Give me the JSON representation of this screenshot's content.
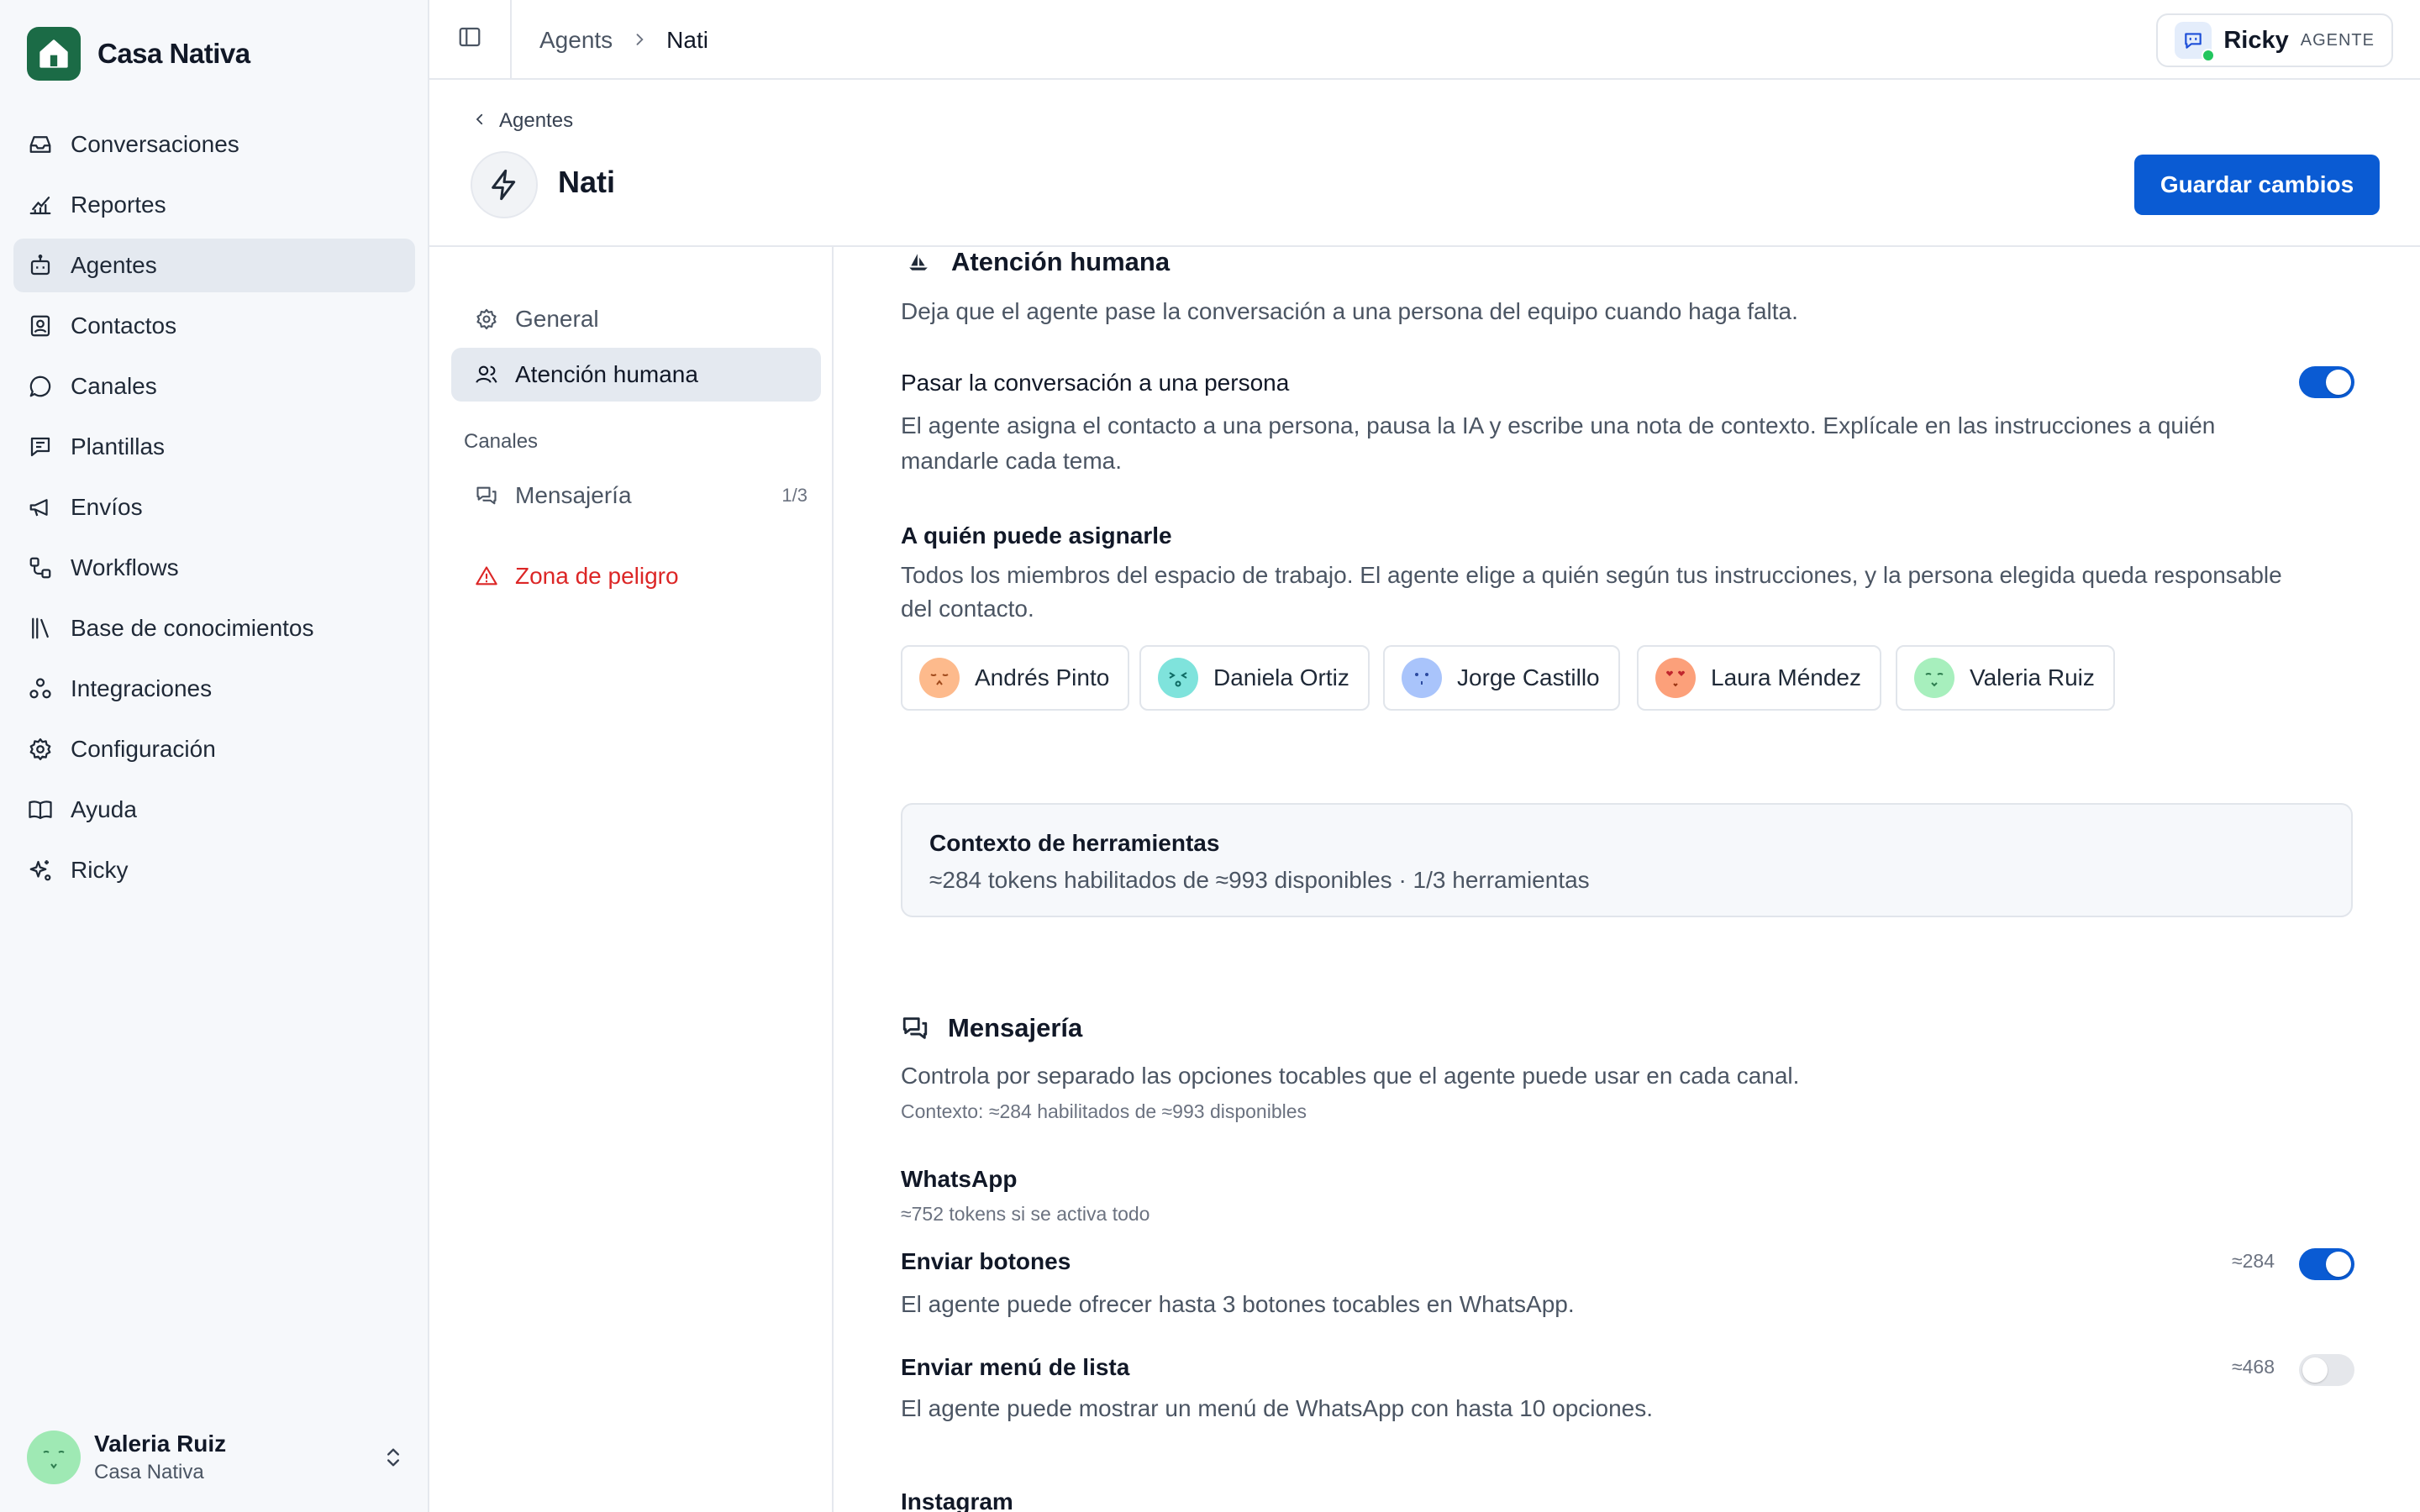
{
  "brand": {
    "name": "Casa Nativa"
  },
  "nav": {
    "items": [
      {
        "label": "Conversaciones",
        "icon": "inbox-icon"
      },
      {
        "label": "Reportes",
        "icon": "chart-line-icon"
      },
      {
        "label": "Agentes",
        "icon": "bot-icon",
        "active": true
      },
      {
        "label": "Contactos",
        "icon": "contact-icon"
      },
      {
        "label": "Canales",
        "icon": "message-circle-icon"
      },
      {
        "label": "Plantillas",
        "icon": "template-icon"
      },
      {
        "label": "Envíos",
        "icon": "megaphone-icon"
      },
      {
        "label": "Workflows",
        "icon": "workflow-icon"
      },
      {
        "label": "Base de conocimientos",
        "icon": "library-icon"
      },
      {
        "label": "Integraciones",
        "icon": "integrations-icon"
      },
      {
        "label": "Configuración",
        "icon": "gear-icon"
      },
      {
        "label": "Ayuda",
        "icon": "book-icon"
      },
      {
        "label": "Ricky",
        "icon": "sparkles-icon"
      }
    ]
  },
  "user": {
    "name": "Valeria Ruiz",
    "workspace": "Casa Nativa"
  },
  "topbar": {
    "breadcrumb": [
      "Agents",
      "Nati"
    ],
    "assistant": {
      "name": "Ricky",
      "role": "AGENTE"
    }
  },
  "header": {
    "back_label": "Agentes",
    "agent_name": "Nati",
    "save_label": "Guardar cambios"
  },
  "subnav": {
    "general": "General",
    "human": "Atención humana",
    "group_label": "Canales",
    "messaging": "Mensajería",
    "messaging_count": "1/3",
    "danger": "Zona de peligro"
  },
  "human_section": {
    "title": "Atención humana",
    "description": "Deja que el agente pase la conversación a una persona del equipo cuando haga falta.",
    "handoff_label": "Pasar la conversación a una persona",
    "handoff_enabled": true,
    "handoff_desc_1": "El agente asigna el contacto a una persona, pausa la IA y escribe una nota de contexto. Explícale en las instrucciones a quién",
    "handoff_desc_2": "mandarle cada tema.",
    "assign_title": "A quién puede asignarle",
    "assign_desc_1": "Todos los miembros del espacio de trabajo. El agente elige a quién según tus instrucciones, y la persona elegida queda responsable",
    "assign_desc_2": "del contacto.",
    "members": [
      {
        "name": "Andrés Pinto",
        "color": "#fdba8c"
      },
      {
        "name": "Daniela Ortiz",
        "color": "#7fe3dc"
      },
      {
        "name": "Jorge Castillo",
        "color": "#a9c4fb"
      },
      {
        "name": "Laura Méndez",
        "color": "#fca07a"
      },
      {
        "name": "Valeria Ruiz",
        "color": "#a7efbd"
      }
    ]
  },
  "tool_context": {
    "title": "Contexto de herramientas",
    "detail": "≈284 tokens habilitados de ≈993 disponibles · 1/3 herramientas"
  },
  "messaging_section": {
    "title": "Mensajería",
    "description": "Controla por separado las opciones tocables que el agente puede usar en cada canal.",
    "context": "Contexto: ≈284 habilitados de ≈993 disponibles",
    "whatsapp": {
      "title": "WhatsApp",
      "subtitle": "≈752 tokens si se activa todo",
      "buttons_label": "Enviar botones",
      "buttons_tokens": "≈284",
      "buttons_enabled": true,
      "buttons_desc": "El agente puede ofrecer hasta 3 botones tocables en WhatsApp.",
      "list_label": "Enviar menú de lista",
      "list_tokens": "≈468",
      "list_enabled": false,
      "list_desc": "El agente puede mostrar un menú de WhatsApp con hasta 10 opciones."
    },
    "instagram_title": "Instagram"
  },
  "colors": {
    "accent": "#0a5bd3",
    "brand": "#1b6b46",
    "danger": "#dc2626",
    "online": "#22c55e"
  }
}
